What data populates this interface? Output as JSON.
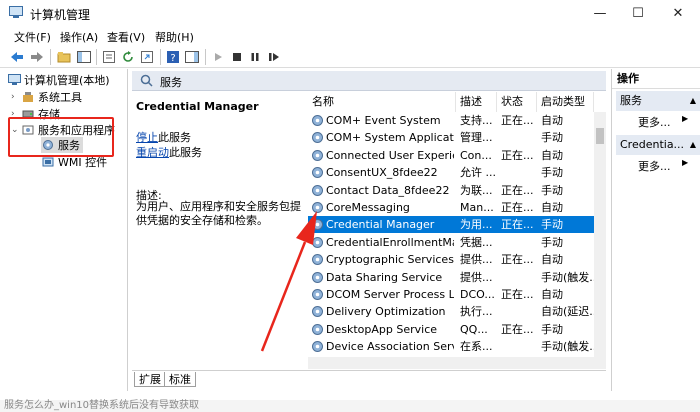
{
  "window": {
    "title": "计算机管理",
    "minimize": "—",
    "maximize": "☐",
    "close": "✕"
  },
  "menu": [
    "文件(F)",
    "操作(A)",
    "查看(V)",
    "帮助(H)"
  ],
  "tree": {
    "root": "计算机管理(本地)",
    "items": [
      "系统工具",
      "存储",
      "服务和应用程序",
      "服务",
      "WMI 控件"
    ]
  },
  "panel": {
    "header": "服务",
    "service_name": "Credential Manager",
    "stop_link": "停止",
    "stop_suffix": "此服务",
    "restart_link": "重启动",
    "restart_suffix": "此服务",
    "desc_label": "描述:",
    "desc_text": "为用户、应用程序和安全服务包提供凭据的安全存储和检索。"
  },
  "columns": [
    "名称",
    "描述",
    "状态",
    "启动类型"
  ],
  "services": [
    {
      "name": "COM+ Event System",
      "desc": "支持...",
      "status": "正在...",
      "startup": "自动"
    },
    {
      "name": "COM+ System Application",
      "desc": "管理...",
      "status": "",
      "startup": "手动"
    },
    {
      "name": "Connected User Experien...",
      "desc": "Con...",
      "status": "正在...",
      "startup": "自动"
    },
    {
      "name": "ConsentUX_8fdee22",
      "desc": "允许 ...",
      "status": "",
      "startup": "手动"
    },
    {
      "name": "Contact Data_8fdee22",
      "desc": "为联...",
      "status": "正在...",
      "startup": "手动"
    },
    {
      "name": "CoreMessaging",
      "desc": "Man...",
      "status": "正在...",
      "startup": "自动"
    },
    {
      "name": "Credential Manager",
      "desc": "为用...",
      "status": "正在...",
      "startup": "手动"
    },
    {
      "name": "CredentialEnrollmentMan...",
      "desc": "凭据...",
      "status": "",
      "startup": "手动"
    },
    {
      "name": "Cryptographic Services",
      "desc": "提供...",
      "status": "正在...",
      "startup": "自动"
    },
    {
      "name": "Data Sharing Service",
      "desc": "提供...",
      "status": "",
      "startup": "手动(触发..."
    },
    {
      "name": "DCOM Server Process La...",
      "desc": "DCO...",
      "status": "正在...",
      "startup": "自动"
    },
    {
      "name": "Delivery Optimization",
      "desc": "执行...",
      "status": "",
      "startup": "自动(延迟..."
    },
    {
      "name": "DesktopApp Service",
      "desc": "QQ...",
      "status": "正在...",
      "startup": "手动"
    },
    {
      "name": "Device Association Service",
      "desc": "在系...",
      "status": "",
      "startup": "手动(触发..."
    }
  ],
  "selected_service_index": 6,
  "tabs": [
    "扩展",
    "标准"
  ],
  "actions": {
    "title": "操作",
    "group1": "服务",
    "group1_more": "更多...",
    "group2": "Credentia...",
    "group2_more": "更多..."
  },
  "footer_text": "服务怎么办_win10替换系统后没有导致获取",
  "colors": {
    "selection": "#0078d7",
    "highlight_box": "#e8261c",
    "arrow": "#e8261c",
    "link": "#0645ad"
  }
}
